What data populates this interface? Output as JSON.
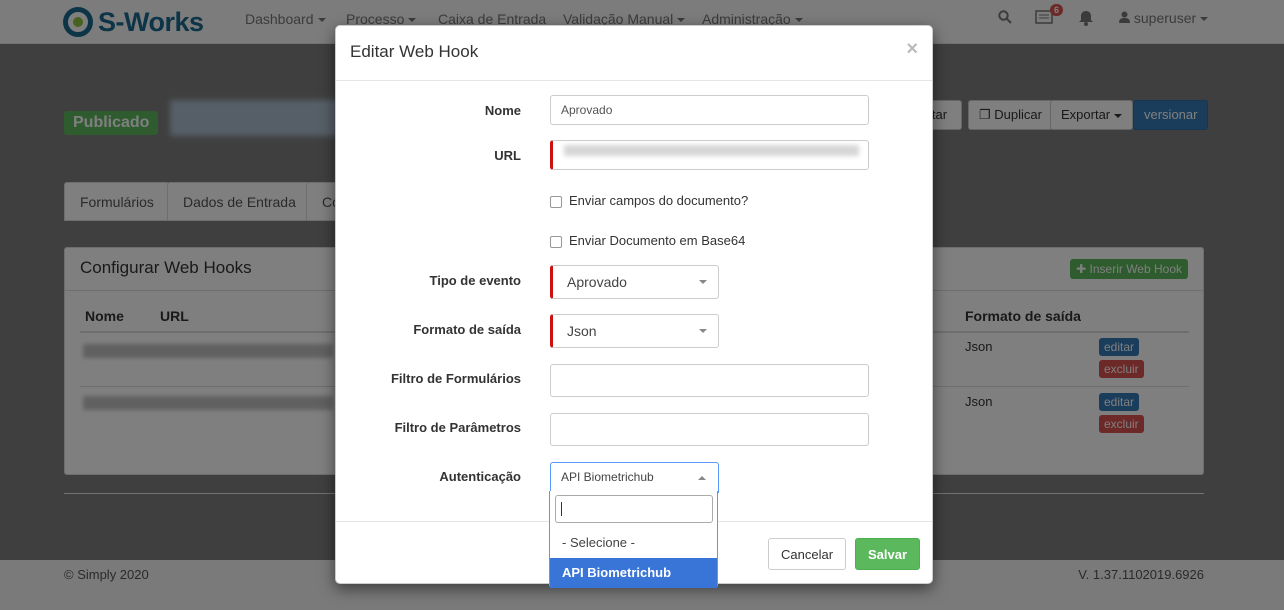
{
  "navbar": {
    "brand": "S-Works",
    "menus": [
      "Dashboard",
      "Processo",
      "Caixa de Entrada",
      "Validação Manual",
      "Administração"
    ],
    "notification_count": "6",
    "user": "superuser"
  },
  "page": {
    "status_label": "Publicado",
    "buttons": {
      "edit": "itar",
      "duplicate": "Duplicar",
      "export": "Exportar",
      "version": "versionar"
    },
    "tabs": [
      "Formulários",
      "Dados de Entrada",
      "Co"
    ],
    "panel_title": "Configurar Web Hooks",
    "insert_button": "Inserir Web Hook",
    "table": {
      "headers": [
        "Nome",
        "URL",
        "Formato de saída"
      ],
      "rows": [
        {
          "format": "Json",
          "edit": "editar",
          "delete": "excluir"
        },
        {
          "format": "Json",
          "edit": "editar",
          "delete": "excluir"
        }
      ]
    },
    "footer_left": "© Simply 2020",
    "footer_right": "V. 1.37.1102019.6926"
  },
  "modal": {
    "title": "Editar Web Hook",
    "close": "×",
    "fields": {
      "nome_label": "Nome",
      "nome_value": "Aprovado",
      "url_label": "URL",
      "send_fields_label": "Enviar campos do documento?",
      "send_base64_label": "Enviar Documento em Base64",
      "event_type_label": "Tipo de evento",
      "event_type_value": "Aprovado",
      "output_format_label": "Formato de saída",
      "output_format_value": "Json",
      "form_filter_label": "Filtro de Formulários",
      "param_filter_label": "Filtro de Parâmetros",
      "auth_label": "Autenticação",
      "auth_value": "API Biometrichub"
    },
    "auth_dropdown": {
      "options": [
        "- Selecione -",
        "API Biometrichub"
      ],
      "highlighted": 1
    },
    "buttons": {
      "cancel": "Cancelar",
      "save": "Salvar"
    }
  }
}
